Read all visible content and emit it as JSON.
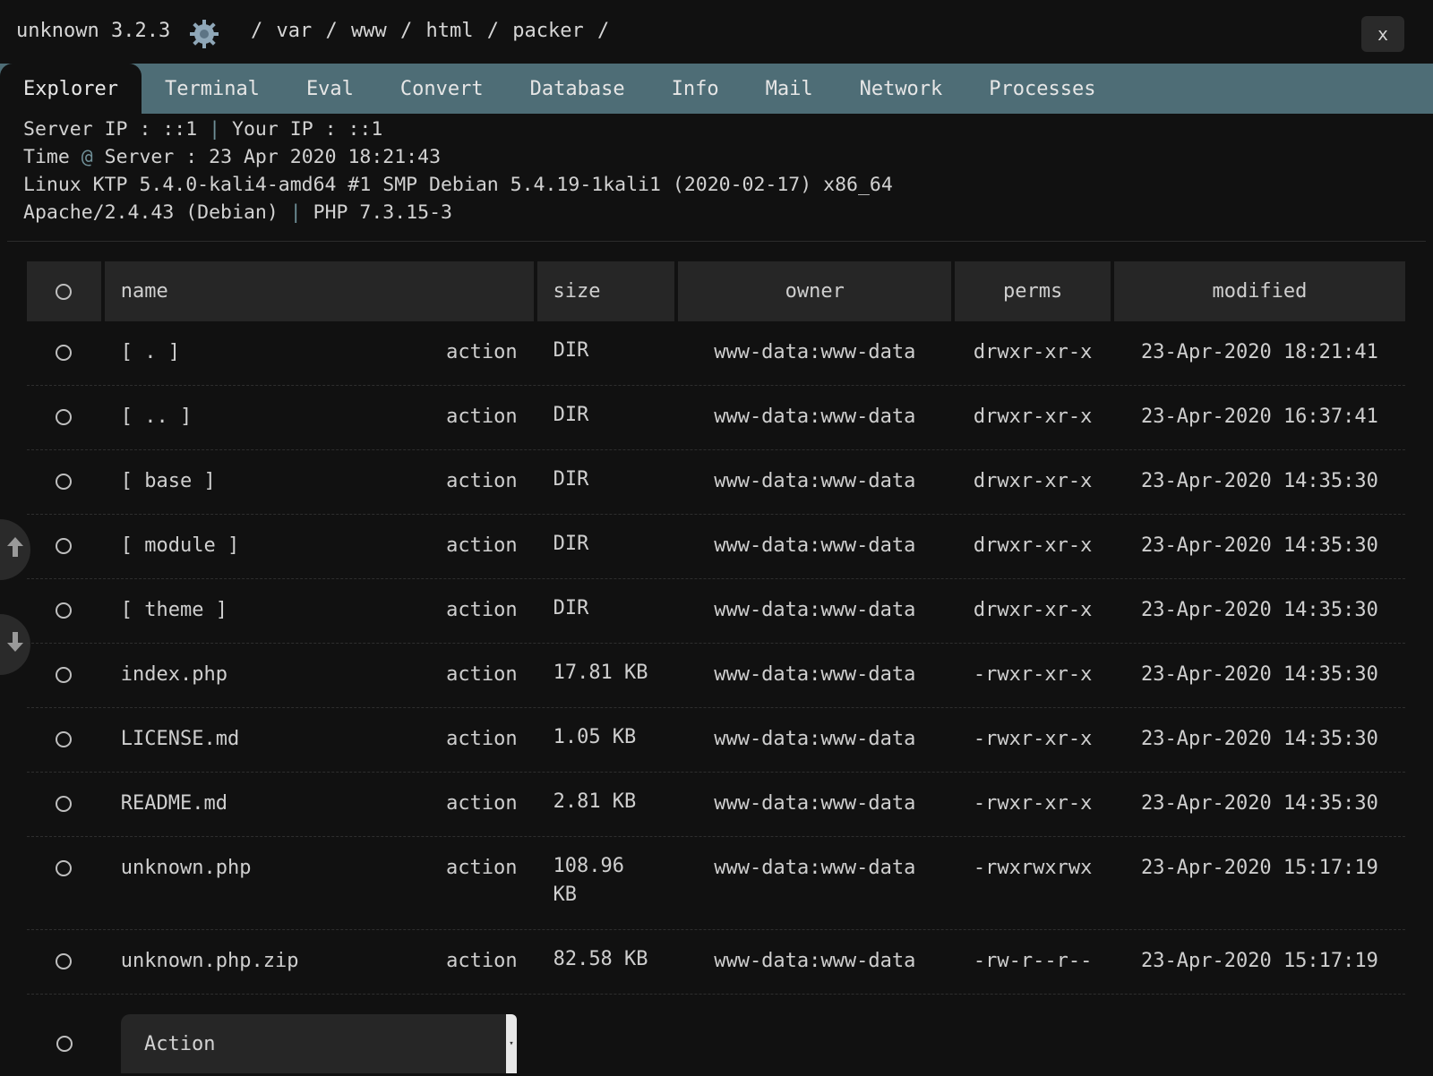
{
  "header": {
    "app_title": "unknown 3.2.3",
    "path": [
      "/",
      "var",
      "/",
      "www",
      "/",
      "html",
      "/",
      "packer",
      "/"
    ],
    "close_label": "x"
  },
  "tabs": [
    {
      "label": "Explorer",
      "active": true
    },
    {
      "label": "Terminal"
    },
    {
      "label": "Eval"
    },
    {
      "label": "Convert"
    },
    {
      "label": "Database"
    },
    {
      "label": "Info"
    },
    {
      "label": "Mail"
    },
    {
      "label": "Network"
    },
    {
      "label": "Processes"
    }
  ],
  "info": {
    "server_ip": "Server IP : ::1",
    "your_ip": "Your IP : ::1",
    "time_label": "Time",
    "time_at": "@",
    "time_value": "Server : 23 Apr 2020 18:21:43",
    "uname": "Linux KTP 5.4.0-kali4-amd64 #1 SMP Debian 5.4.19-1kali1 (2020-02-17) x86_64",
    "apache": "Apache/2.4.43 (Debian)",
    "php": "PHP 7.3.15-3",
    "separator": "|"
  },
  "table": {
    "headers": {
      "name": "name",
      "size": "size",
      "owner": "owner",
      "perms": "perms",
      "modified": "modified"
    },
    "action_label": "action",
    "rows": [
      {
        "name": "[ . ]",
        "size": "DIR",
        "owner": "www-data:www-data",
        "perms": "drwxr-xr-x",
        "modified": "23-Apr-2020 18:21:41"
      },
      {
        "name": "[ .. ]",
        "size": "DIR",
        "owner": "www-data:www-data",
        "perms": "drwxr-xr-x",
        "modified": "23-Apr-2020 16:37:41"
      },
      {
        "name": "[ base ]",
        "size": "DIR",
        "owner": "www-data:www-data",
        "perms": "drwxr-xr-x",
        "modified": "23-Apr-2020 14:35:30"
      },
      {
        "name": "[ module ]",
        "size": "DIR",
        "owner": "www-data:www-data",
        "perms": "drwxr-xr-x",
        "modified": "23-Apr-2020 14:35:30"
      },
      {
        "name": "[ theme ]",
        "size": "DIR",
        "owner": "www-data:www-data",
        "perms": "drwxr-xr-x",
        "modified": "23-Apr-2020 14:35:30"
      },
      {
        "name": "index.php",
        "size": "17.81 KB",
        "owner": "www-data:www-data",
        "perms": "-rwxr-xr-x",
        "modified": "23-Apr-2020 14:35:30"
      },
      {
        "name": "LICENSE.md",
        "size": "1.05 KB",
        "owner": "www-data:www-data",
        "perms": "-rwxr-xr-x",
        "modified": "23-Apr-2020 14:35:30"
      },
      {
        "name": "README.md",
        "size": "2.81 KB",
        "owner": "www-data:www-data",
        "perms": "-rwxr-xr-x",
        "modified": "23-Apr-2020 14:35:30"
      },
      {
        "name": "unknown.php",
        "size": "108.96 KB",
        "owner": "www-data:www-data",
        "perms": "-rwxrwxrwx",
        "modified": "23-Apr-2020 15:17:19"
      },
      {
        "name": "unknown.php.zip",
        "size": "82.58 KB",
        "owner": "www-data:www-data",
        "perms": "-rw-r--r--",
        "modified": "23-Apr-2020 15:17:19"
      }
    ]
  },
  "footer": {
    "action_select_value": "Action"
  },
  "colors": {
    "tab_bar": "#4e6d76",
    "background": "#111111",
    "header_cell": "#262626"
  },
  "icons": {
    "logo": "gear-icon",
    "side_up": "upload-icon",
    "side_down": "download-icon"
  }
}
